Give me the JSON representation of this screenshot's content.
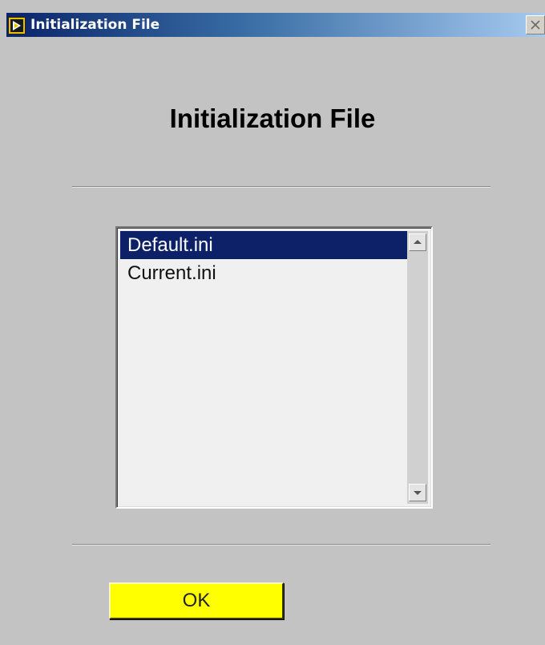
{
  "window": {
    "title": "Initialization File",
    "icon": "labview-run-icon",
    "close_icon": "close-icon"
  },
  "dialog": {
    "heading": "Initialization File"
  },
  "file_list": {
    "items": [
      {
        "label": "Default.ini",
        "selected": true
      },
      {
        "label": "Current.ini",
        "selected": false
      }
    ],
    "scroll_up_icon": "scroll-up-arrow-icon",
    "scroll_down_icon": "scroll-down-arrow-icon"
  },
  "buttons": {
    "ok_label": "OK"
  },
  "colors": {
    "selection": "#0c2168",
    "ok_button": "#ffff00",
    "title_bar_start": "#0a246a",
    "title_bar_end": "#a6caf0",
    "background": "#c3c3c3"
  }
}
